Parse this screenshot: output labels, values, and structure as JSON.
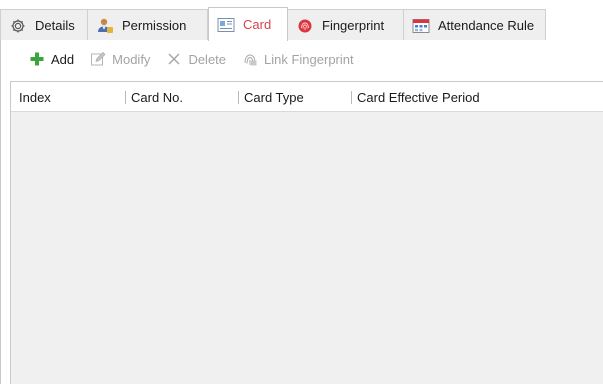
{
  "tabs": [
    {
      "label": "Details",
      "icon": "gear-icon",
      "active": false
    },
    {
      "label": "Permission",
      "icon": "user-permission-icon",
      "active": false
    },
    {
      "label": "Card",
      "icon": "card-icon",
      "active": true
    },
    {
      "label": "Fingerprint",
      "icon": "fingerprint-icon",
      "active": false
    },
    {
      "label": "Attendance Rule",
      "icon": "calendar-icon",
      "active": false
    }
  ],
  "toolbar": {
    "add_label": "Add",
    "modify_label": "Modify",
    "delete_label": "Delete",
    "link_fingerprint_label": "Link Fingerprint"
  },
  "table": {
    "columns": [
      "Index",
      "Card No.",
      "Card Type",
      "Card Effective Period"
    ],
    "rows": []
  },
  "colors": {
    "active_tab_text": "#d8434b",
    "add_icon": "#3aa53a",
    "disabled_text": "#a3a3a3",
    "table_body_bg": "#f0f0f0"
  }
}
